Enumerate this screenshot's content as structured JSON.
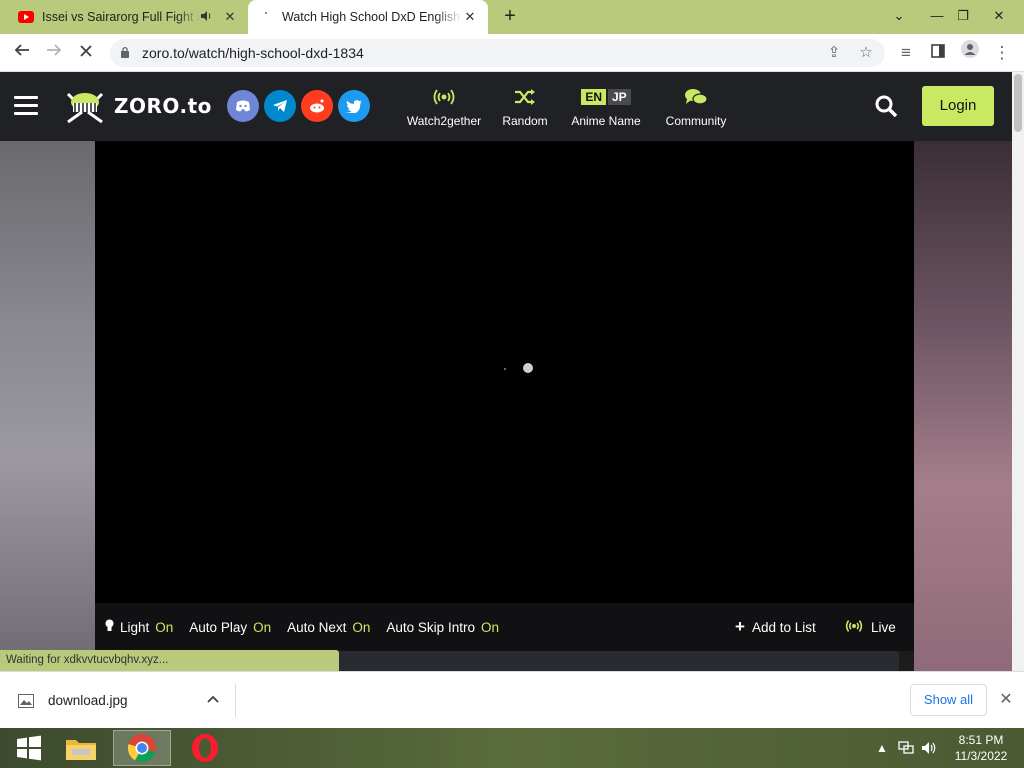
{
  "browser": {
    "tabs": [
      {
        "title": "Issei vs Sairarorg Full Fight in",
        "favicon": "youtube-icon",
        "audio": true
      },
      {
        "title": "Watch High School DxD English",
        "favicon": "loading-spinner-icon",
        "active": true
      }
    ],
    "new_tab": "+",
    "address": "zoro.to/watch/high-school-dxd-1834",
    "status_text": "Waiting for xdkvvtucvbqhv.xyz..."
  },
  "site": {
    "logo_text": "ZORO.to",
    "social": [
      {
        "name": "discord-icon",
        "color": "#6f85d5"
      },
      {
        "name": "telegram-icon",
        "color": "#0088cc"
      },
      {
        "name": "reddit-icon",
        "color": "#ff3c1f"
      },
      {
        "name": "twitter-icon",
        "color": "#1d9bf0"
      }
    ],
    "nav": {
      "watch2gether": "Watch2gether",
      "random": "Random",
      "anime_name": "Anime Name",
      "lang_en": "EN",
      "lang_jp": "JP",
      "community": "Community"
    },
    "login": "Login",
    "accent": "#cae962"
  },
  "player": {
    "controls": {
      "light": "Light",
      "light_state": "On",
      "autoplay": "Auto Play",
      "autoplay_state": "On",
      "autonext": "Auto Next",
      "autonext_state": "On",
      "autoskip": "Auto Skip Intro",
      "autoskip_state": "On",
      "add_to_list": "Add to List",
      "live": "Live"
    }
  },
  "downloads": {
    "file": "download.jpg",
    "show_all": "Show all"
  },
  "taskbar": {
    "time": "8:51 PM",
    "date": "11/3/2022"
  }
}
